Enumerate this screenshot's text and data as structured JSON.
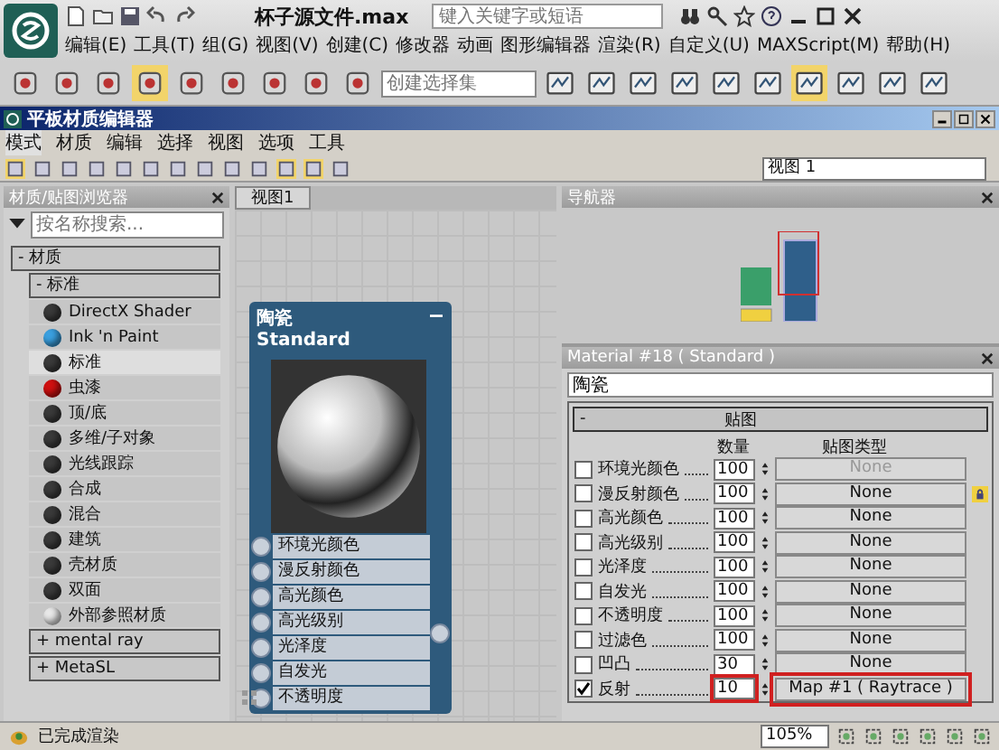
{
  "app": {
    "title": "杯子源文件.max",
    "search": {
      "placeholder": "键入关键字或短语"
    },
    "menu": [
      "编辑(E)",
      "工具(T)",
      "组(G)",
      "视图(V)",
      "创建(C)",
      "修改器",
      "动画",
      "图形编辑器",
      "渲染(R)",
      "自定义(U)",
      "MAXScript(M)",
      "帮助(H)"
    ],
    "selection_set": {
      "placeholder": "创建选择集"
    }
  },
  "editor": {
    "title": "平板材质编辑器",
    "menu": [
      {
        "label": "模式",
        "selected": true
      },
      {
        "label": "材质",
        "selected": false
      },
      {
        "label": "编辑",
        "selected": false
      },
      {
        "label": "选择",
        "selected": false
      },
      {
        "label": "视图",
        "selected": false
      },
      {
        "label": "选项",
        "selected": false
      },
      {
        "label": "工具",
        "selected": false
      }
    ],
    "view_select": "视图 1"
  },
  "browser": {
    "title": "材质/贴图浏览器",
    "search": {
      "placeholder": "按名称搜索..."
    },
    "groups": [
      {
        "label": "- 材质",
        "children": [
          {
            "label": "- 标准",
            "children": [
              {
                "label": "DirectX Shader",
                "color": "#3a3a3a",
                "selected": false
              },
              {
                "label": "Ink 'n Paint",
                "color": "#3aa0e0",
                "selected": false
              },
              {
                "label": "标准",
                "color": "#3a3a3a",
                "selected": true
              },
              {
                "label": "虫漆",
                "color": "#d01010",
                "selected": false
              },
              {
                "label": "顶/底",
                "color": "#3a3a3a",
                "selected": false
              },
              {
                "label": "多维/子对象",
                "color": "#3a3a3a",
                "selected": false
              },
              {
                "label": "光线跟踪",
                "color": "#3a3a3a",
                "selected": false
              },
              {
                "label": "合成",
                "color": "#3a3a3a",
                "selected": false
              },
              {
                "label": "混合",
                "color": "#3a3a3a",
                "selected": false
              },
              {
                "label": "建筑",
                "color": "#3a3a3a",
                "selected": false
              },
              {
                "label": "壳材质",
                "color": "#3a3a3a",
                "selected": false
              },
              {
                "label": "双面",
                "color": "#3a3a3a",
                "selected": false
              },
              {
                "label": "外部参照材质",
                "color": "#e8e8e8",
                "selected": false
              }
            ]
          },
          {
            "label": "+ mental ray"
          },
          {
            "label": "+ MetaSL"
          }
        ]
      }
    ]
  },
  "view": {
    "tab": "视图1",
    "node": {
      "name": "陶瓷",
      "type": "Standard",
      "slots": [
        "环境光颜色",
        "漫反射颜色",
        "高光颜色",
        "高光级别",
        "光泽度",
        "自发光",
        "不透明度"
      ]
    }
  },
  "navigator": {
    "title": "导航器"
  },
  "material": {
    "title": "Material #18  ( Standard )",
    "name": "陶瓷",
    "rollout": "-",
    "rollout_title": "贴图",
    "columns": [
      "数量",
      "贴图类型"
    ],
    "rows": [
      {
        "label": "环境光颜色",
        "checked": false,
        "amount": "100",
        "map": "None",
        "disabled": true,
        "highlighted": false
      },
      {
        "label": "漫反射颜色",
        "checked": false,
        "amount": "100",
        "map": "None",
        "disabled": false,
        "highlighted": false
      },
      {
        "label": "高光颜色",
        "checked": false,
        "amount": "100",
        "map": "None",
        "disabled": false,
        "highlighted": false
      },
      {
        "label": "高光级别",
        "checked": false,
        "amount": "100",
        "map": "None",
        "disabled": false,
        "highlighted": false
      },
      {
        "label": "光泽度",
        "checked": false,
        "amount": "100",
        "map": "None",
        "disabled": false,
        "highlighted": false
      },
      {
        "label": "自发光",
        "checked": false,
        "amount": "100",
        "map": "None",
        "disabled": false,
        "highlighted": false
      },
      {
        "label": "不透明度",
        "checked": false,
        "amount": "100",
        "map": "None",
        "disabled": false,
        "highlighted": false
      },
      {
        "label": "过滤色",
        "checked": false,
        "amount": "100",
        "map": "None",
        "disabled": false,
        "highlighted": false
      },
      {
        "label": "凹凸",
        "checked": false,
        "amount": "30",
        "map": "None",
        "disabled": false,
        "highlighted": false
      },
      {
        "label": "反射",
        "checked": true,
        "amount": "10",
        "map": "Map #1  ( Raytrace )",
        "disabled": false,
        "highlighted": true
      }
    ]
  },
  "status": {
    "text": "已完成渲染",
    "zoom": "105%"
  }
}
